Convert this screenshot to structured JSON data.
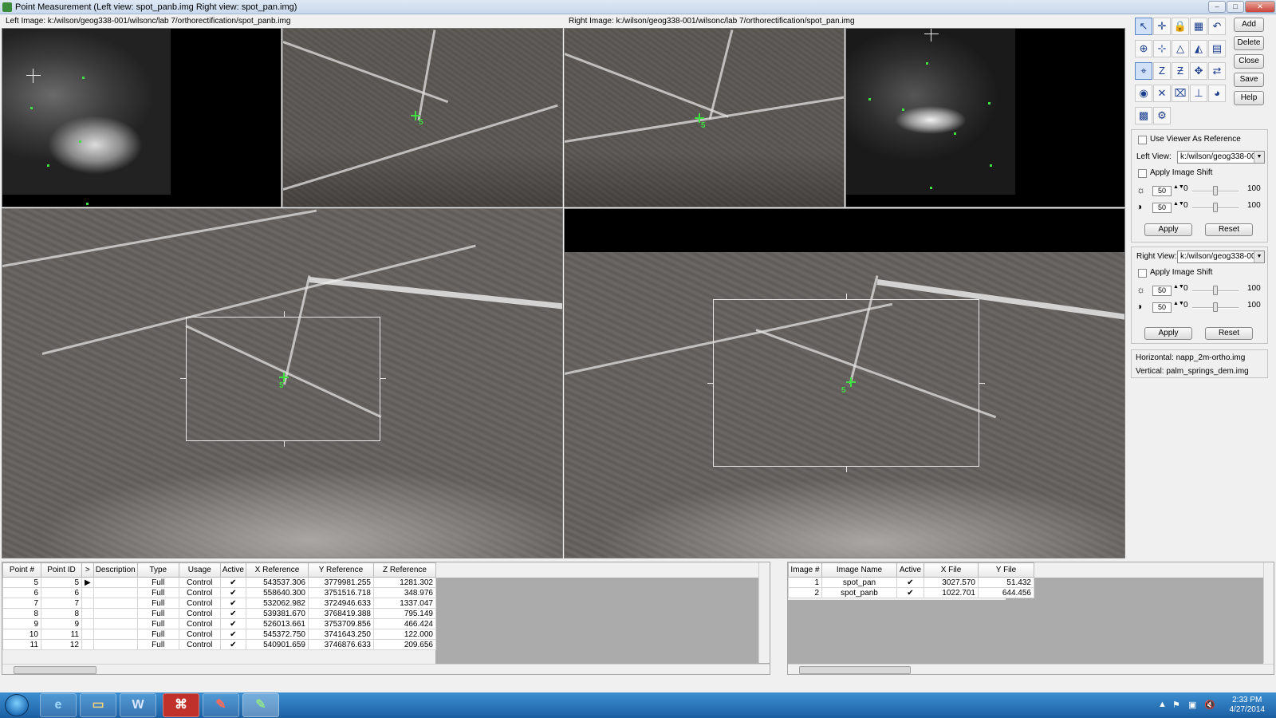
{
  "window": {
    "title": "Point Measurement (Left view: spot_panb.img  Right view: spot_pan.img)",
    "buttons": {
      "minimize": "–",
      "maximize": "□",
      "close": "✕"
    }
  },
  "paths": {
    "left": "Left Image: k:/wilson/geog338-001/wilsonc/lab 7/orthorectification/spot_panb.img",
    "right": "Right Image: k:/wilson/geog338-001/wilsonc/lab 7/orthorectification/spot_pan.img"
  },
  "viewers": {
    "gcp_label": "5"
  },
  "toolbar": {
    "side_buttons": {
      "add": "Add",
      "delete": "Delete",
      "close": "Close",
      "save": "Save",
      "help": "Help"
    },
    "icons": [
      "select-icon",
      "crosshair-icon",
      "lock-icon",
      "table-icon",
      "undo-icon",
      "zoom-in-icon",
      "create-point-icon",
      "triangle-icon",
      "compute-icon",
      "report-icon",
      "link-cursor-icon",
      "z-icon",
      "z-update-icon",
      "auto-tie-icon",
      "drive-icon",
      "color-icon",
      "delete-point-icon",
      "fit-icon",
      "elevation-icon",
      "pie-icon",
      "grid-icon",
      "settings-icon"
    ]
  },
  "panel": {
    "use_viewer_reference": "Use Viewer As Reference",
    "left_view_label": "Left View:",
    "left_view_value": "k:/wilson/geog338-00",
    "apply_image_shift": "Apply Image Shift",
    "brightness": "50",
    "contrast": "50",
    "min": "0",
    "max": "100",
    "apply": "Apply",
    "reset": "Reset",
    "right_view_label": "Right View:",
    "right_view_value": "k:/wilson/geog338-00",
    "horizontal": "Horizontal: napp_2m-ortho.img",
    "vertical": "Vertical: palm_springs_dem.img"
  },
  "points_table": {
    "headers": [
      "Point #",
      "Point ID",
      ">",
      "Description",
      "Type",
      "Usage",
      "Active",
      "X Reference",
      "Y Reference",
      "Z Reference"
    ],
    "rows": [
      [
        "5",
        "5",
        "▶",
        "",
        "Full",
        "Control",
        "✔",
        "543537.306",
        "3779981.255",
        "1281.302"
      ],
      [
        "6",
        "6",
        "",
        "",
        "Full",
        "Control",
        "✔",
        "558640.300",
        "3751516.718",
        "348.976"
      ],
      [
        "7",
        "7",
        "",
        "",
        "Full",
        "Control",
        "✔",
        "532062.982",
        "3724946.633",
        "1337.047"
      ],
      [
        "8",
        "8",
        "",
        "",
        "Full",
        "Control",
        "✔",
        "539381.670",
        "3768419.388",
        "795.149"
      ],
      [
        "9",
        "9",
        "",
        "",
        "Full",
        "Control",
        "✔",
        "526013.661",
        "3753709.856",
        "466.424"
      ],
      [
        "10",
        "11",
        "",
        "",
        "Full",
        "Control",
        "✔",
        "545372.750",
        "3741643.250",
        "122.000"
      ],
      [
        "11",
        "12",
        "",
        "",
        "Full",
        "Control",
        "✔",
        "540901.659",
        "3746876.633",
        "209.656"
      ]
    ]
  },
  "images_table": {
    "headers": [
      "Image #",
      "Image Name",
      "Active",
      "X File",
      "Y File"
    ],
    "rows": [
      [
        "1",
        "spot_pan",
        "✔",
        "3027.570",
        "51.432"
      ],
      [
        "2",
        "spot_panb",
        "✔",
        "1022.701",
        "644.456"
      ]
    ]
  },
  "taskbar": {
    "items": [
      "ie-icon",
      "explorer-icon",
      "word-icon",
      "acrobat-icon",
      "erdas-icon",
      "erdas-icon"
    ],
    "word_letter": "W",
    "time": "2:33 PM",
    "date": "4/27/2014"
  }
}
